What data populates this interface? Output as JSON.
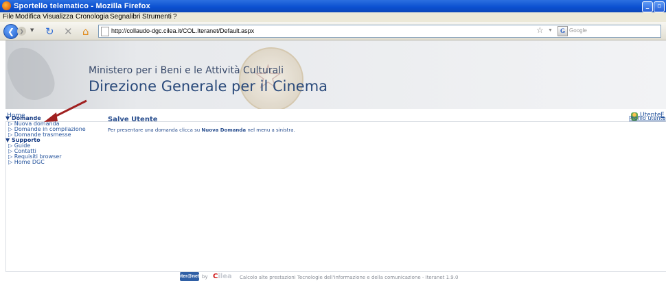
{
  "browser": {
    "title": "Sportello telematico - Mozilla Firefox",
    "menu": [
      "File",
      "Modifica",
      "Visualizza",
      "Cronologia",
      "Segnalibri",
      "Strumenti",
      "?"
    ],
    "url": "http://collaudo-dgc.cilea.it/COL.Iteranet/Default.aspx",
    "search_placeholder": "Google"
  },
  "header": {
    "line1": "Ministero per i Beni e le Attività Culturali",
    "line2": "Direzione Generale per il Cinema"
  },
  "homebar": {
    "home": "Home",
    "utente": "Utente",
    "esci": "E"
  },
  "sidebar": {
    "groups": [
      {
        "label": "Domande",
        "items": [
          "Nuova domanda",
          "Domande in compilazione",
          "Domande trasmesse"
        ]
      },
      {
        "label": "Supporto",
        "items": [
          "Guide",
          "Contatti",
          "Requisiti browser",
          "Home DGC"
        ]
      }
    ]
  },
  "main": {
    "title": "Salve Utente",
    "text_prefix": "Per presentare una domanda clicca su ",
    "text_bold": "Nuova Domanda",
    "text_suffix": " nel menu a sinistra.",
    "profilo": "Profilo utente"
  },
  "footer": {
    "logo1": "iter@net",
    "by": "by",
    "logo2_c": "C",
    "logo2_rest": "ilea",
    "text": "Calcolo alte prestazioni Tecnologie dell'informazione e della comunicazione - Iteranet 1.9.0"
  },
  "colors": {
    "accent": "#1f4f9a",
    "title_bar": "#0a4fd0",
    "arrow": "#a02020"
  }
}
